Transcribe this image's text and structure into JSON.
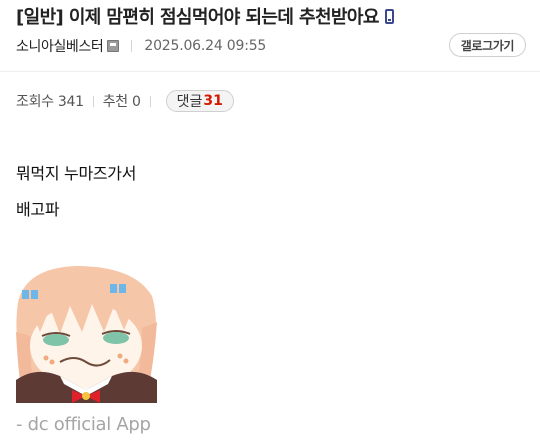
{
  "post": {
    "title": "[일반] 이제 맘편히 점심먹어야 되는데 추천받아요",
    "author": "소니아실베스터",
    "date": "2025.06.24 09:55",
    "gallery_button": "갤로그가기",
    "stats": {
      "views_label": "조회수 341",
      "recommend_label": "추천 0",
      "comments_label": "댓글",
      "comments_count": "31"
    },
    "body_lines": [
      "뭐먹지 누마즈가서",
      "배고파"
    ],
    "signature": "- dc official App"
  },
  "colors": {
    "accent_blue": "#3b4890",
    "comment_count_red": "#d31900",
    "muted_text": "#a5a5a5"
  },
  "icons": {
    "title_suffix": "mobile-phone-icon",
    "nickname_badge": "fixed-nickname-icon"
  }
}
